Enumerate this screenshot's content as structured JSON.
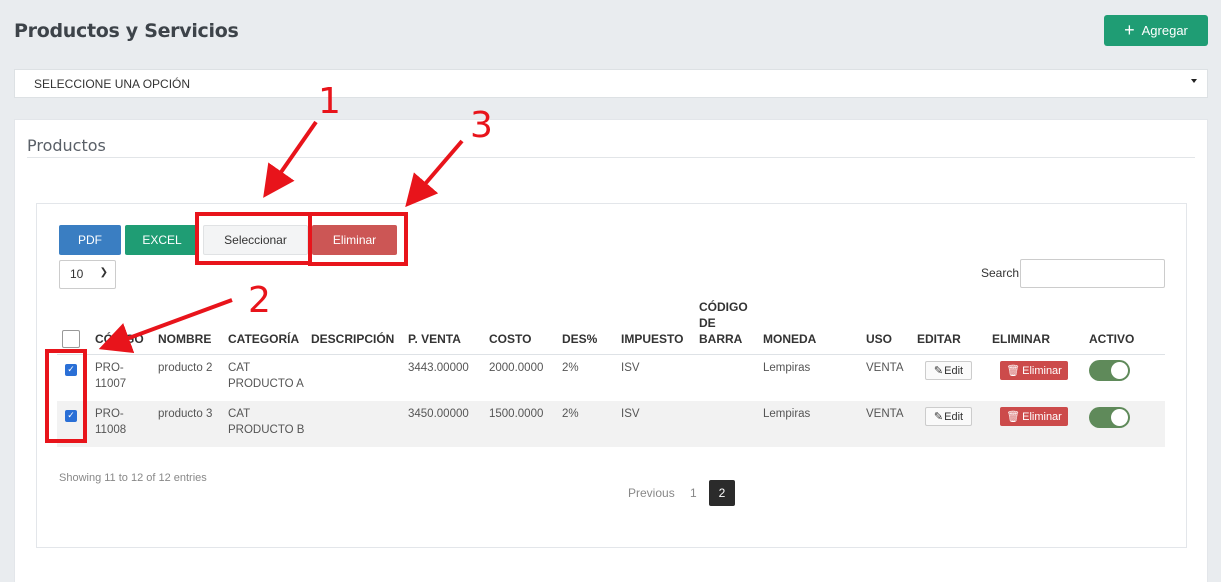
{
  "header": {
    "title": "Productos y Servicios",
    "add_label": "Agregar",
    "add_icon": "plus-icon"
  },
  "selector": {
    "value": "SELECCIONE UNA OPCIÓN"
  },
  "card": {
    "title": "Productos"
  },
  "toolbar": {
    "pdf": "PDF",
    "excel": "EXCEL",
    "select": "Seleccionar",
    "delete": "Eliminar"
  },
  "length": {
    "value": "10"
  },
  "search": {
    "label": "Search:"
  },
  "table": {
    "headers": {
      "codigo": "CÓDIGO",
      "nombre": "NOMBRE",
      "categoria": "CATEGORÍA",
      "descripcion": "DESCRIPCIÓN",
      "pventa": "P. VENTA",
      "costo": "COSTO",
      "des": "DES%",
      "impuesto": "IMPUESTO",
      "barra_1": "CÓDIGO",
      "barra_2": "DE",
      "barra_3": "BARRA",
      "moneda": "MONEDA",
      "uso": "USO",
      "editar": "EDITAR",
      "eliminar": "ELIMINAR",
      "activo": "ACTIVO"
    },
    "rows": [
      {
        "codigo_1": "PRO-",
        "codigo_2": "11007",
        "nombre": "producto 2",
        "categoria_1": "CAT",
        "categoria_2": "PRODUCTO A",
        "pventa": "3443.00000",
        "costo": "2000.0000",
        "des": "2%",
        "impuesto": "ISV",
        "moneda": "Lempiras",
        "uso": "VENTA",
        "edit": "Edit",
        "delete": "Eliminar",
        "checked": true,
        "active": true
      },
      {
        "codigo_1": "PRO-",
        "codigo_2": "11008",
        "nombre": "producto 3",
        "categoria_1": "CAT",
        "categoria_2": "PRODUCTO B",
        "pventa": "3450.00000",
        "costo": "1500.0000",
        "des": "2%",
        "impuesto": "ISV",
        "moneda": "Lempiras",
        "uso": "VENTA",
        "edit": "Edit",
        "delete": "Eliminar",
        "checked": true,
        "active": true
      }
    ]
  },
  "footer": {
    "showing": "Showing 11 to 12 of 12 entries",
    "previous": "Previous",
    "page_1": "1",
    "page_2": "2"
  },
  "annotations": {
    "a1": "1",
    "a2": "2",
    "a3": "3"
  },
  "colors": {
    "primary_green": "#1f9d74",
    "pdf_blue": "#3a7ec2",
    "danger_red": "#cc5655",
    "annotation_red": "#e8141b",
    "toggle_green": "#5f8a5a"
  }
}
